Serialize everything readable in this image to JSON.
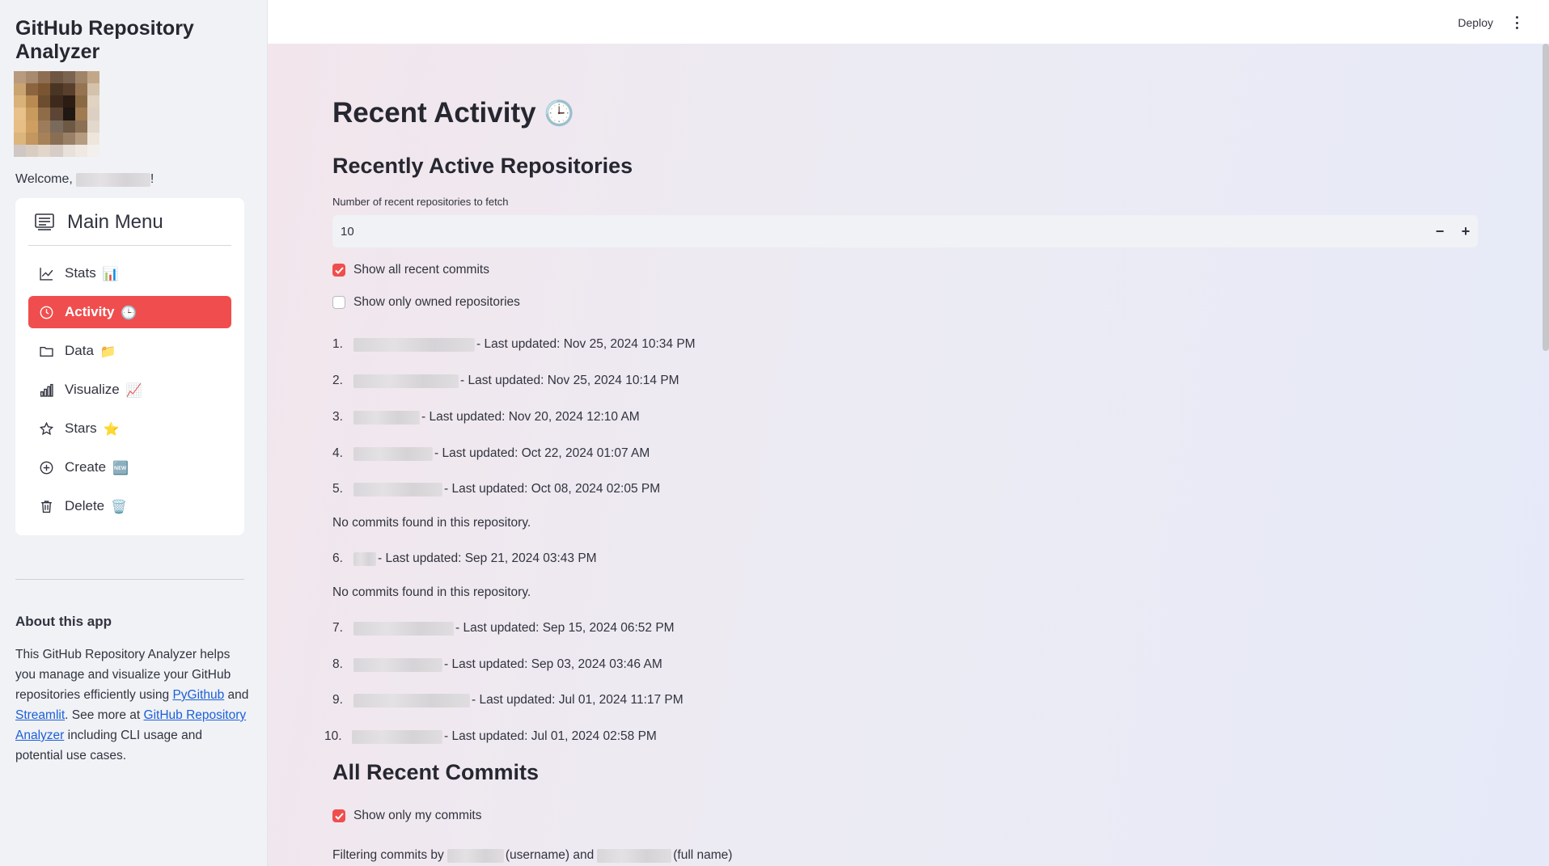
{
  "app": {
    "title": "GitHub Repository Analyzer"
  },
  "sidebar": {
    "welcome_prefix": "Welcome,",
    "welcome_suffix": "!",
    "menu": {
      "title": "Main Menu",
      "items": [
        {
          "label": "Stats",
          "emoji": "📊",
          "icon": "line-chart-icon",
          "active": false
        },
        {
          "label": "Activity",
          "emoji": "🕒",
          "icon": "clock-icon",
          "active": true
        },
        {
          "label": "Data",
          "emoji": "📁",
          "icon": "folder-icon",
          "active": false
        },
        {
          "label": "Visualize",
          "emoji": "📈",
          "icon": "bar-chart-icon",
          "active": false
        },
        {
          "label": "Stars",
          "emoji": "⭐",
          "icon": "star-icon",
          "active": false
        },
        {
          "label": "Create",
          "emoji": "🆕",
          "icon": "plus-circle-icon",
          "active": false
        },
        {
          "label": "Delete",
          "emoji": "🗑️",
          "icon": "trash-icon",
          "active": false
        }
      ]
    },
    "about": {
      "title": "About this app",
      "text1": "This GitHub Repository Analyzer helps you manage and visualize your GitHub repositories efficiently using ",
      "link_pygithub": "PyGithub",
      "text2": " and ",
      "link_streamlit": "Streamlit",
      "text3": ". See more at ",
      "link_analyzer": "GitHub Repository Analyzer",
      "text4": " including CLI usage and potential use cases."
    }
  },
  "topbar": {
    "deploy": "Deploy"
  },
  "main": {
    "title": "Recent Activity",
    "title_emoji": "🕒",
    "section1": "Recently Active Repositories",
    "input_label": "Number of recent repositories to fetch",
    "input_value": "10",
    "minus": "−",
    "plus": "+",
    "check_all_commits": "Show all recent commits",
    "check_owned": "Show only owned repositories",
    "no_commits": "No commits found in this repository.",
    "repos": [
      {
        "num": "1.",
        "updated": "- Last updated: Nov 25, 2024 10:34 PM"
      },
      {
        "num": "2.",
        "updated": "- Last updated: Nov 25, 2024 10:14 PM"
      },
      {
        "num": "3.",
        "updated": "- Last updated: Nov 20, 2024 12:10 AM"
      },
      {
        "num": "4.",
        "updated": "- Last updated: Oct 22, 2024 01:07 AM"
      },
      {
        "num": "5.",
        "updated": "- Last updated: Oct 08, 2024 02:05 PM"
      },
      {
        "num": "6.",
        "updated": "- Last updated: Sep 21, 2024 03:43 PM"
      },
      {
        "num": "7.",
        "updated": "- Last updated: Sep 15, 2024 06:52 PM"
      },
      {
        "num": "8.",
        "updated": "- Last updated: Sep 03, 2024 03:46 AM"
      },
      {
        "num": "9.",
        "updated": "- Last updated: Jul 01, 2024 11:17 PM"
      },
      {
        "num": "10.",
        "updated": "- Last updated: Jul 01, 2024 02:58 PM"
      }
    ],
    "section2": "All Recent Commits",
    "check_my_commits": "Show only my commits",
    "filter_prefix": "Filtering commits by",
    "filter_username": "(username) and",
    "filter_fullname": "(full name)"
  },
  "colors": {
    "accent": "#f04e4e",
    "link": "#1c5fd6",
    "sidebar_bg": "#f0f2f6"
  }
}
